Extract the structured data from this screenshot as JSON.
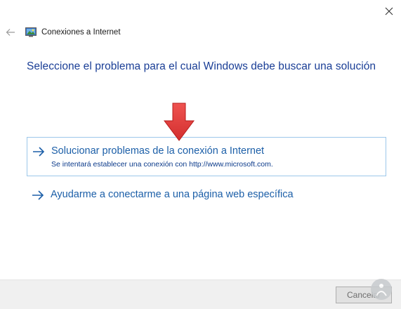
{
  "window": {
    "title": "Conexiones a Internet",
    "close_icon": "close-icon",
    "back_icon": "back-arrow-icon",
    "app_icon": "network-connections-icon"
  },
  "main": {
    "heading": "Seleccione el problema para el cual Windows debe buscar una solución",
    "options": [
      {
        "title": "Solucionar problemas de la conexión a Internet",
        "description": "Se intentará establecer una conexión con http://www.microsoft.com.",
        "icon": "arrow-right-icon"
      },
      {
        "title": "Ayudarme a conectarme a una página web específica",
        "icon": "arrow-right-icon"
      }
    ]
  },
  "footer": {
    "cancel_label": "Cancelar"
  },
  "colors": {
    "heading": "#1a3e96",
    "link": "#1c5fa8",
    "option_border": "#9cc7ea",
    "annotation_arrow": "#e53935"
  }
}
